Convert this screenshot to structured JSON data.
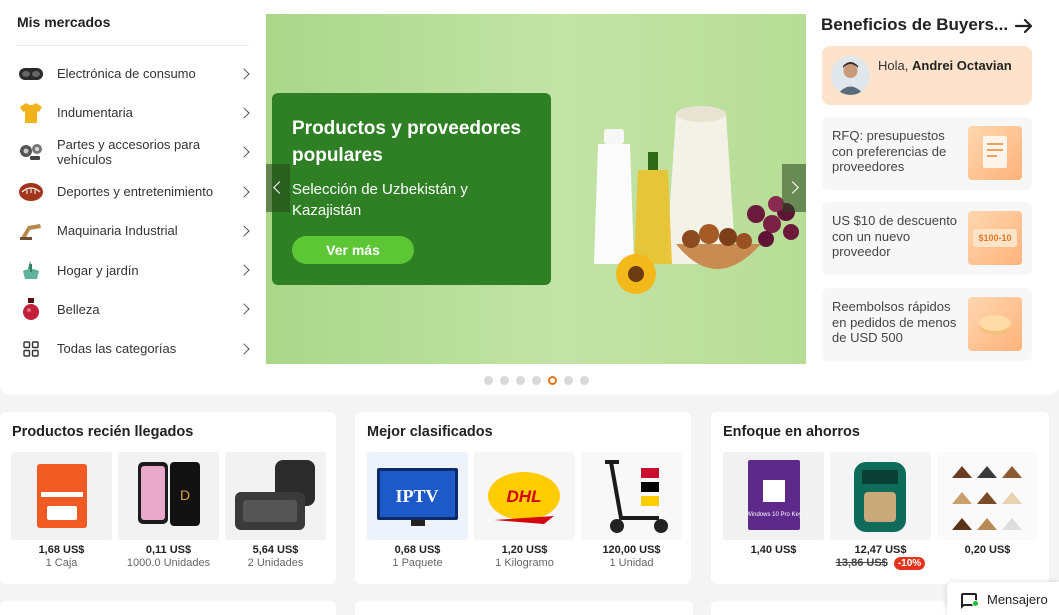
{
  "markets": {
    "title": "Mis mercados",
    "items": [
      {
        "label": "Electrónica de consumo",
        "icon": "vr-headset-icon"
      },
      {
        "label": "Indumentaria",
        "icon": "tshirt-icon"
      },
      {
        "label": "Partes y accesorios para vehículos",
        "icon": "car-parts-icon"
      },
      {
        "label": "Deportes y entretenimiento",
        "icon": "sports-ball-icon"
      },
      {
        "label": "Maquinaria Industrial",
        "icon": "machinery-icon"
      },
      {
        "label": "Hogar y jardín",
        "icon": "garden-tools-icon"
      },
      {
        "label": "Belleza",
        "icon": "perfume-icon"
      },
      {
        "label": "Todas las categorías",
        "icon": "grid-icon"
      }
    ]
  },
  "banner": {
    "title": "Productos y proveedores populares",
    "subtitle": "Selección de Uzbekistán y Kazajistán",
    "button": "Ver más",
    "dots_total": 7,
    "active_dot": 5
  },
  "benefits": {
    "title": "Beneficios de Buyers...",
    "greeting": "Hola,",
    "user_name": "Andrei Octavian",
    "cards": [
      {
        "text": "RFQ: presupuestos con preferencias de proveedores"
      },
      {
        "text": "US $10 de descuento con un nuevo proveedor",
        "badge": "$100-10"
      },
      {
        "text": "Reembolsos rápidos en pedidos de menos de USD 500"
      }
    ]
  },
  "sections": [
    {
      "title": "Productos recién llegados",
      "products": [
        {
          "price": "1,68 US$",
          "unit": "1 Caja",
          "image": "office365-card"
        },
        {
          "price": "0,11 US$",
          "unit": "1000.0 Unidades",
          "image": "phone-screen-protector"
        },
        {
          "price": "5,64 US$",
          "unit": "2 Unidades",
          "image": "diaper-backpack"
        }
      ]
    },
    {
      "title": "Mejor clasificados",
      "products": [
        {
          "price": "0,68 US$",
          "unit": "1 Paquete",
          "image": "iptv-tv",
          "image_text": "IPTV"
        },
        {
          "price": "1,20 US$",
          "unit": "1 Kilogramo",
          "image": "dhl-shipping",
          "image_text": "DHL"
        },
        {
          "price": "120,00 US$",
          "unit": "1 Unidad",
          "image": "electric-scooter"
        }
      ]
    },
    {
      "title": "Enfoque en ahorros",
      "products": [
        {
          "price": "1,40 US$",
          "unit": "",
          "image": "windows10-key",
          "image_text": "Windows 10 Pro Key"
        },
        {
          "price": "12,47 US$",
          "old_price": "13,86 US$",
          "discount": "-10%",
          "image": "air-fryer"
        },
        {
          "price": "0,20 US$",
          "unit": "",
          "image": "display-hangers"
        }
      ]
    }
  ],
  "messenger": {
    "label": "Mensajero"
  }
}
